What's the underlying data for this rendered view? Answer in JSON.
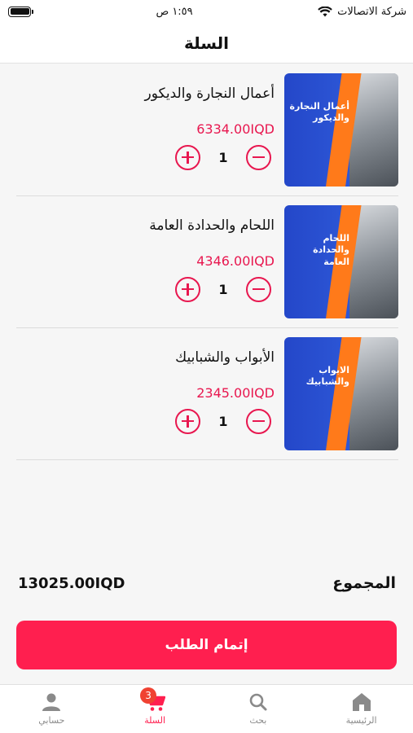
{
  "status_bar": {
    "time": "١:٥٩ ص",
    "carrier": "شركة الاتصالات"
  },
  "header": {
    "title": "السلة"
  },
  "cart": {
    "items": [
      {
        "name": "أعمال النجارة والديكور",
        "price": "6334.00IQD",
        "quantity": "1",
        "thumb_title": "أعمال النجارة والديكور"
      },
      {
        "name": "اللحام والحدادة العامة",
        "price": "4346.00IQD",
        "quantity": "1",
        "thumb_title": "اللحام والحدادة العامة"
      },
      {
        "name": "الأبواب والشبابيك",
        "price": "2345.00IQD",
        "quantity": "1",
        "thumb_title": "الابواب والشبابيك"
      }
    ]
  },
  "total": {
    "label": "المجموع",
    "amount": "13025.00IQD"
  },
  "checkout": {
    "label": "إتمام الطلب"
  },
  "bottom_nav": {
    "items": [
      {
        "label": "حسابي",
        "icon": "person-icon"
      },
      {
        "label": "السلة",
        "icon": "cart-icon",
        "badge": "3"
      },
      {
        "label": "بحث",
        "icon": "search-icon"
      },
      {
        "label": "الرئيسية",
        "icon": "home-icon"
      }
    ]
  },
  "colors": {
    "accent": "#ff1f4f",
    "price": "#e8174f",
    "badge": "#f04232"
  }
}
